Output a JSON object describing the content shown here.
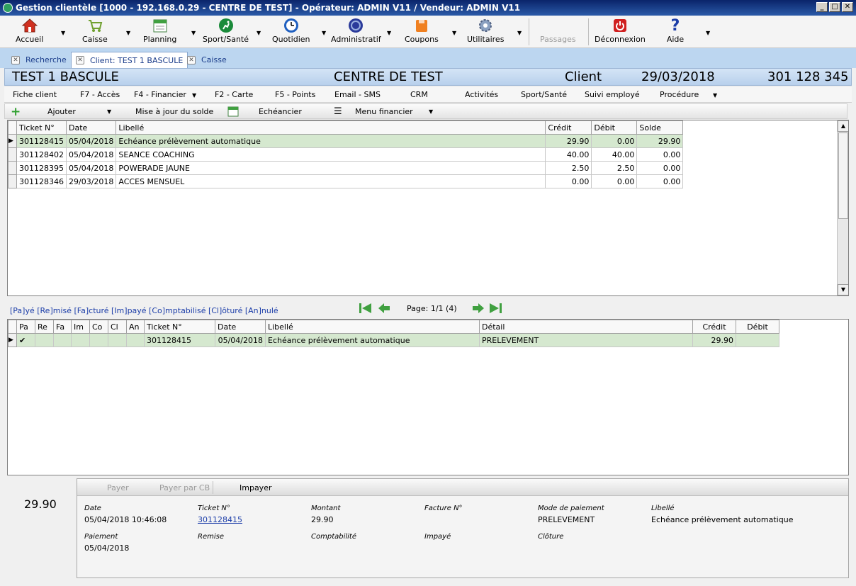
{
  "window": {
    "title": "Gestion clientèle [1000 - 192.168.0.29 - CENTRE DE TEST] - Opérateur: ADMIN V11 / Vendeur: ADMIN V11"
  },
  "toolbar": {
    "accueil": "Accueil",
    "caisse": "Caisse",
    "planning": "Planning",
    "sport_sante": "Sport/Santé",
    "quotidien": "Quotidien",
    "administratif": "Administratif",
    "coupons": "Coupons",
    "utilitaires": "Utilitaires",
    "passages": "Passages",
    "deconnexion": "Déconnexion",
    "aide": "Aide"
  },
  "tabs": [
    "Recherche",
    "Client: TEST 1 BASCULE",
    "Caisse"
  ],
  "header": {
    "name": "TEST 1 BASCULE",
    "center": "CENTRE DE TEST",
    "type": "Client",
    "date": "29/03/2018",
    "number": "301 128 345"
  },
  "menu": [
    "Fiche client",
    "F7 - Accès",
    "F4 - Financier",
    "F2 - Carte",
    "F5 - Points",
    "Email - SMS",
    "CRM",
    "Activités",
    "Sport/Santé",
    "Suivi employé",
    "Procédure"
  ],
  "actions": {
    "ajouter": "Ajouter",
    "mise_a_jour": "Mise à jour du solde",
    "echeancier": "Echéancier",
    "menu_financier": "Menu financier"
  },
  "grid1": {
    "headers": [
      "Ticket N°",
      "Date",
      "Libellé",
      "Crédit",
      "Débit",
      "Solde"
    ],
    "rows": [
      [
        "301128415",
        "05/04/2018",
        "Echéance prélèvement automatique",
        "29.90",
        "0.00",
        "29.90"
      ],
      [
        "301128402",
        "05/04/2018",
        "SEANCE COACHING",
        "40.00",
        "40.00",
        "0.00"
      ],
      [
        "301128395",
        "05/04/2018",
        "POWERADE JAUNE",
        "2.50",
        "2.50",
        "0.00"
      ],
      [
        "301128346",
        "29/03/2018",
        "ACCES MENSUEL",
        "0.00",
        "0.00",
        "0.00"
      ]
    ]
  },
  "legend": "[Pa]yé [Re]misé [Fa]cturé [Im]payé [Co]mptabilisé [Cl]ôturé [An]nulé",
  "pager": {
    "text": "Page: 1/1 (4)"
  },
  "grid2": {
    "headers": [
      "Pa",
      "Re",
      "Fa",
      "Im",
      "Co",
      "Cl",
      "An",
      "Ticket N°",
      "Date",
      "Libellé",
      "Détail",
      "Crédit",
      "Débit"
    ],
    "rows": [
      [
        "✔",
        "",
        "",
        "",
        "",
        "",
        "",
        "301128415",
        "05/04/2018",
        "Echéance prélèvement automatique",
        "PRELEVEMENT",
        "29.90",
        ""
      ]
    ]
  },
  "amount": "29.90",
  "paybar": {
    "payer": "Payer",
    "payer_cb": "Payer par CB",
    "impayer": "Impayer"
  },
  "details": {
    "date_lbl": "Date",
    "date_val": "05/04/2018 10:46:08",
    "ticket_lbl": "Ticket N°",
    "ticket_val": "301128415",
    "montant_lbl": "Montant",
    "montant_val": "29.90",
    "facture_lbl": "Facture N°",
    "mode_lbl": "Mode de paiement",
    "mode_val": "PRELEVEMENT",
    "libelle_lbl": "Libellé",
    "libelle_val": "Echéance prélèvement automatique",
    "paiement_lbl": "Paiement",
    "paiement_val": "05/04/2018",
    "remise_lbl": "Remise",
    "compta_lbl": "Comptabilité",
    "impaye_lbl": "Impayé",
    "cloture_lbl": "Clôture"
  },
  "colors": {
    "selected_row": "#d5e8cf",
    "header_blue": "#b8d0ec",
    "link": "#1a3ca8"
  }
}
